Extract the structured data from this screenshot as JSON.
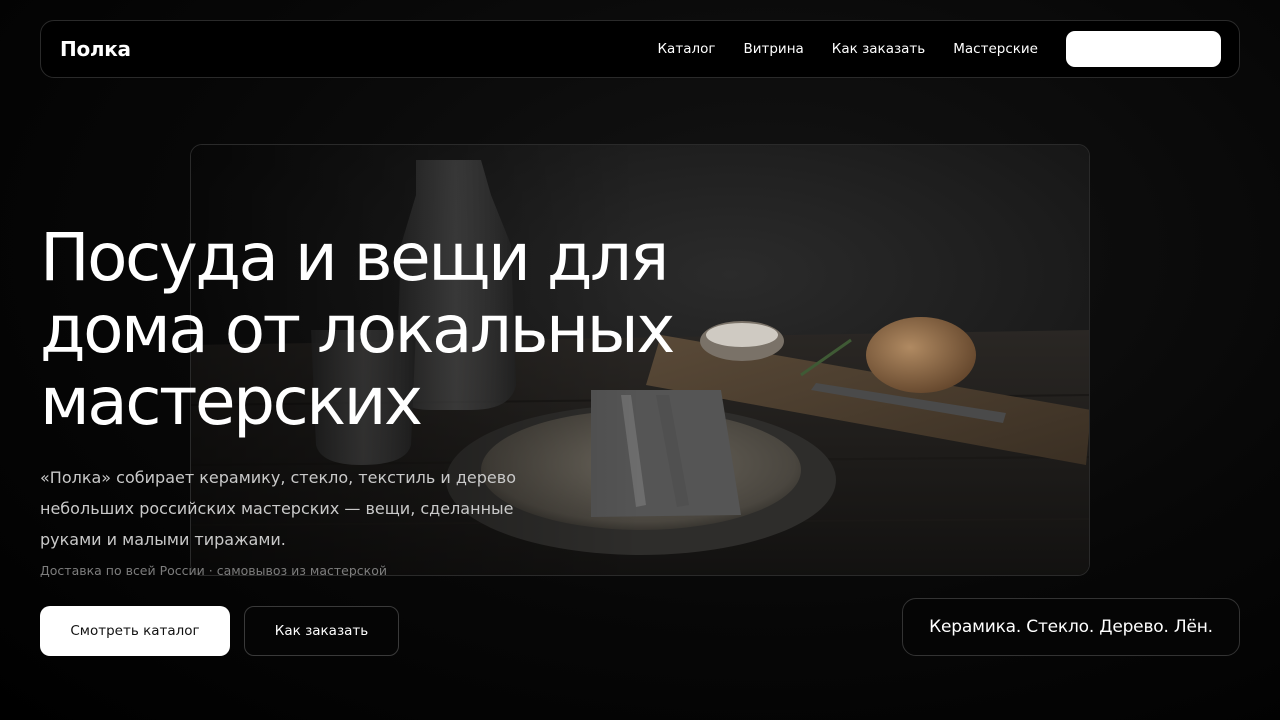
{
  "header": {
    "logo": "Полка",
    "nav": [
      "Каталог",
      "Витрина",
      "Как заказать",
      "Мастерские"
    ],
    "cta_label": ""
  },
  "hero": {
    "title_lines": [
      "Посуда и вещи для",
      "дома от локальных",
      "мастерских"
    ],
    "description_lines": [
      "«Полка» собирает керамику, стекло, текстиль и дерево",
      "небольших российских мастерских — вещи, сделанные",
      "руками и малыми тиражами."
    ],
    "note": "Доставка по всей России · самовывоз из мастерской",
    "primary_button": "Смотреть каталог",
    "secondary_button": "Как заказать"
  },
  "badge": {
    "materials": "Керамика. Стекло. Дерево. Лён."
  },
  "colors": {
    "background": "#000000",
    "accent": "#ffffff",
    "border": "#2a2a2a"
  }
}
